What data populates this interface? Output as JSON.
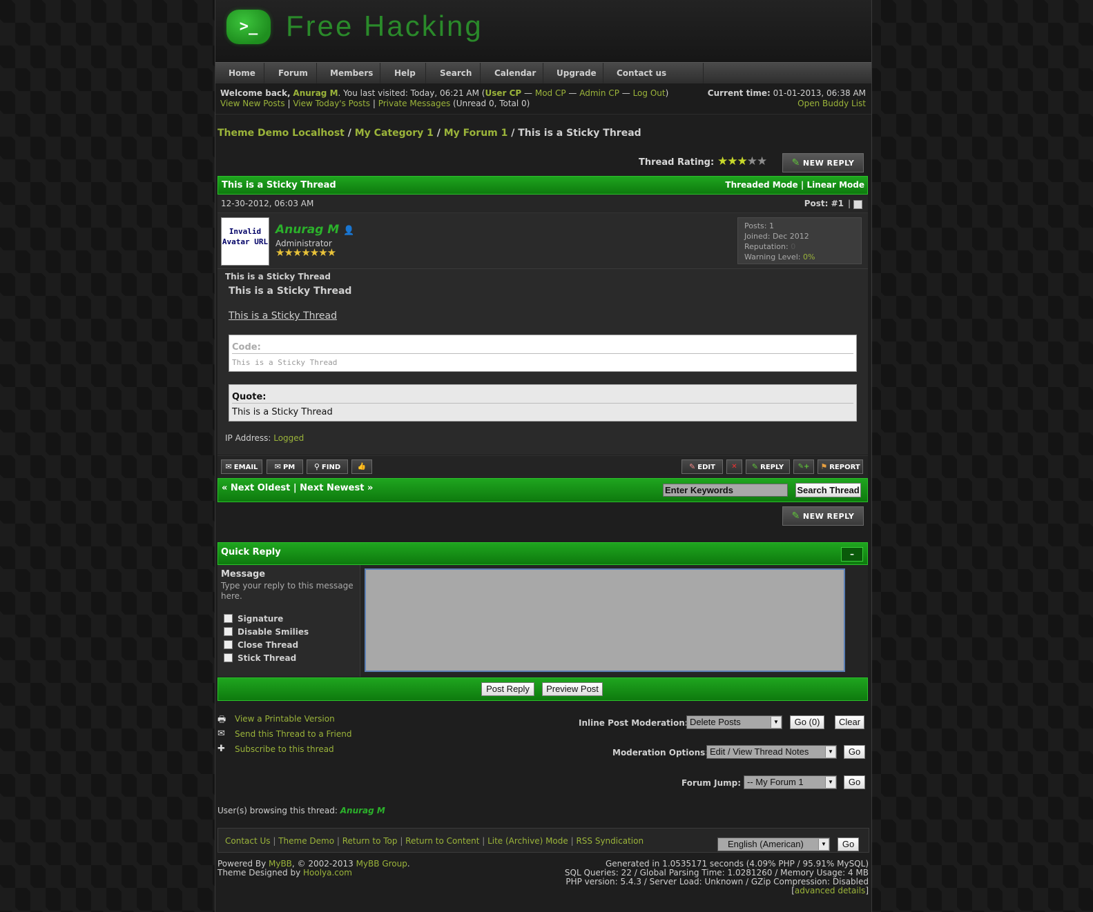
{
  "header": {
    "logo_glyph": ">_",
    "site_name": "Free Hacking"
  },
  "nav": [
    "Home",
    "Forum",
    "Members",
    "Help",
    "Search",
    "Calendar",
    "Upgrade",
    "Contact us"
  ],
  "welcome": {
    "welcome_back": "Welcome back,",
    "username": "Anurag M",
    "last_visited": ". You last visited: Today, 06:21 AM (",
    "user_cp": "User CP",
    "dash1": " — ",
    "mod_cp": "Mod CP",
    "dash2": " — ",
    "admin_cp": "Admin CP",
    "dash3": " — ",
    "log_out": "Log Out",
    "close_paren": ")",
    "view_new_posts": "View New Posts",
    "pipe1": " | ",
    "view_todays_posts": "View Today's Posts",
    "pipe2": " | ",
    "private_messages": "Private Messages",
    "pm_counts": " (Unread 0, Total 0)",
    "current_time_label": "Current time:",
    "current_time": " 01-01-2013, 06:38 AM",
    "buddy_list": "Open Buddy List"
  },
  "breadcrumb": {
    "crumb1": "Theme Demo Localhost",
    "sep1": " / ",
    "crumb2": "My Category 1",
    "sep2": " / ",
    "crumb3": "My Forum 1",
    "sep3": " / ",
    "current": "This is a Sticky Thread"
  },
  "thread": {
    "rating_label": "Thread Rating:",
    "rating_value": 3,
    "rating_max": 5,
    "new_reply_label": "NEW REPLY",
    "title": "This is a Sticky Thread",
    "threaded_mode": "Threaded Mode",
    "mode_sep": " | ",
    "linear_mode": "Linear Mode"
  },
  "post": {
    "date": "12-30-2012, 06:03 AM",
    "post_number": "Post: #1",
    "post_pipe": "|",
    "avatar_text": "Invalid Avatar URL",
    "author": "Anurag M",
    "role": "Administrator",
    "role_stars": 7,
    "stats": {
      "posts_label": "Posts:",
      "posts": " 1",
      "joined_label": "Joined:",
      "joined": " Dec 2012",
      "reputation_label": "Reputation:",
      "reputation": " 0",
      "warning_label": "Warning Level:",
      "warning": " 0%"
    },
    "subject": "This is a Sticky Thread",
    "body_bold": "This is a Sticky Thread",
    "body_link": "This is a Sticky Thread",
    "code_title": "Code:",
    "code_text": "This is a Sticky Thread",
    "quote_title": "Quote:",
    "quote_text": "This is a Sticky Thread",
    "ip_label": "IP Address:",
    "ip_value": " Logged"
  },
  "post_actions": {
    "email": "EMAIL",
    "pm": "PM",
    "find": "FIND",
    "edit": "EDIT",
    "reply": "REPLY",
    "report": "REPORT"
  },
  "thread_nav": {
    "prev_arrow": "«",
    "next_oldest": " Next Oldest",
    "sep": " | ",
    "next_newest": "Next Newest ",
    "next_arrow": "»",
    "search_placeholder": "Enter Keywords",
    "search_button": "Search Thread"
  },
  "quick_reply": {
    "title": "Quick Reply",
    "collapse": "–",
    "message_label": "Message",
    "message_hint": "Type your reply to this message here.",
    "options": [
      "Signature",
      "Disable Smilies",
      "Close Thread",
      "Stick Thread"
    ],
    "post_reply": "Post Reply",
    "preview_post": "Preview Post"
  },
  "tools": {
    "printable": "View a Printable Version",
    "send_friend": "Send this Thread to a Friend",
    "subscribe": "Subscribe to this thread"
  },
  "moderation": {
    "inline_label": "Inline Post Moderation:",
    "inline_selected": "Delete Posts",
    "inline_go": "Go (0)",
    "inline_clear": "Clear",
    "options_label": "Moderation Options:",
    "options_selected": "Edit / View Thread Notes",
    "options_go": "Go",
    "jump_label": "Forum Jump:",
    "jump_selected": "-- My Forum 1",
    "jump_go": "Go"
  },
  "browsing": {
    "label": "User(s) browsing this thread: ",
    "user": "Anurag M"
  },
  "footer": {
    "links": [
      "Contact Us",
      "Theme Demo",
      "Return to Top",
      "Return to Content",
      "Lite (Archive) Mode",
      "RSS Syndication"
    ],
    "language": "English (American)",
    "language_go": "Go",
    "powered_by": "Powered By ",
    "mybb": "MyBB",
    "copyright": ", © 2002-2013 ",
    "mybb_group": "MyBB Group",
    "period": ".",
    "designed_by": "Theme Designed by ",
    "hoolya": "Hoolya.com",
    "stats_line1": "Generated in 1.0535171 seconds (4.09% PHP / 95.91% MySQL)",
    "stats_line2": "SQL Queries: 22 / Global Parsing Time: 1.0281260 / Memory Usage: 4 MB",
    "stats_line3": "PHP version: 5.4.3 / Server Load: Unknown / GZip Compression: Disabled",
    "adv_open": "[",
    "advanced_details": "advanced details",
    "adv_close": "]"
  },
  "colors": {
    "accent_green": "#1a961a",
    "link_green": "#9bb43a",
    "username_green": "#2bb12b"
  }
}
